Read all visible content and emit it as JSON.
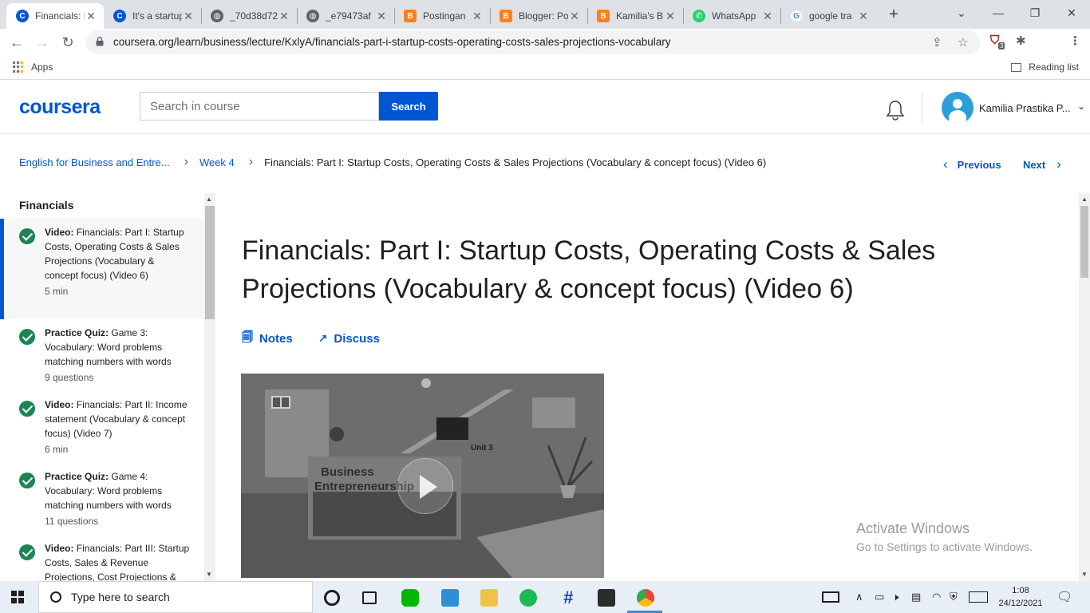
{
  "browser": {
    "tabs": [
      {
        "title": "Financials: Part I",
        "favicon": "coursera-icon",
        "color": "#0056d2",
        "active": true
      },
      {
        "title": "It's a startup",
        "favicon": "coursera-icon",
        "color": "#0056d2",
        "active": false
      },
      {
        "title": "_70d38d72",
        "favicon": "globe-icon",
        "color": "#5f6368",
        "active": false
      },
      {
        "title": "_e79473af",
        "favicon": "globe-icon",
        "color": "#5f6368",
        "active": false
      },
      {
        "title": "Postingan",
        "favicon": "blogger-icon",
        "color": "#f5811f",
        "active": false
      },
      {
        "title": "Blogger: Po",
        "favicon": "blogger-icon",
        "color": "#f5811f",
        "active": false
      },
      {
        "title": "Kamilia's B",
        "favicon": "blogger-icon",
        "color": "#f5811f",
        "active": false
      },
      {
        "title": "WhatsApp",
        "favicon": "whatsapp-icon",
        "color": "#25d366",
        "active": false
      },
      {
        "title": "google tra",
        "favicon": "google-icon",
        "color": "#4285f4",
        "active": false
      }
    ],
    "url": "coursera.org/learn/business/lecture/KxlyA/financials-part-i-startup-costs-operating-costs-sales-projections-vocabulary",
    "bookmarks_apps": "Apps",
    "reading_list": "Reading list",
    "extension_badge": "3"
  },
  "header": {
    "logo": "coursera",
    "search_placeholder": "Search in course",
    "search_button": "Search",
    "user_name": "Kamilia Prastika P..."
  },
  "breadcrumb": {
    "course": "English for Business and Entre...",
    "week": "Week 4",
    "current": "Financials: Part I: Startup Costs, Operating Costs & Sales Projections (Vocabulary & concept focus) (Video 6)",
    "previous": "Previous",
    "next": "Next"
  },
  "sidebar": {
    "title": "Financials",
    "items": [
      {
        "type": "Video:",
        "text": "Financials: Part I: Startup Costs, Operating Costs & Sales Projections (Vocabulary & concept focus) (Video 6)",
        "meta": "5 min"
      },
      {
        "type": "Practice Quiz:",
        "text": "Game 3: Vocabulary: Word problems matching numbers with words",
        "meta": "9 questions"
      },
      {
        "type": "Video:",
        "text": "Financials: Part II: Income statement (Vocabulary & concept focus) (Video 7)",
        "meta": "6 min"
      },
      {
        "type": "Practice Quiz:",
        "text": "Game 4: Vocabulary: Word problems matching numbers with words",
        "meta": "11 questions"
      },
      {
        "type": "Video:",
        "text": "Financials: Part III: Startup Costs, Sales & Revenue Projections, Cost Projections &",
        "meta": ""
      }
    ]
  },
  "main": {
    "title": "Financials: Part I: Startup Costs, Operating Costs & Sales Projections (Vocabulary & concept focus) (Video 6)",
    "notes": "Notes",
    "discuss": "Discuss",
    "video_sign_1": "Business",
    "video_sign_2": "Entrepreneurship",
    "video_unit": "Unit 3"
  },
  "watermark": {
    "line1": "Activate Windows",
    "line2": "Go to Settings to activate Windows."
  },
  "taskbar": {
    "search_placeholder": "Type here to search",
    "time": "1:08",
    "date": "24/12/2021"
  }
}
